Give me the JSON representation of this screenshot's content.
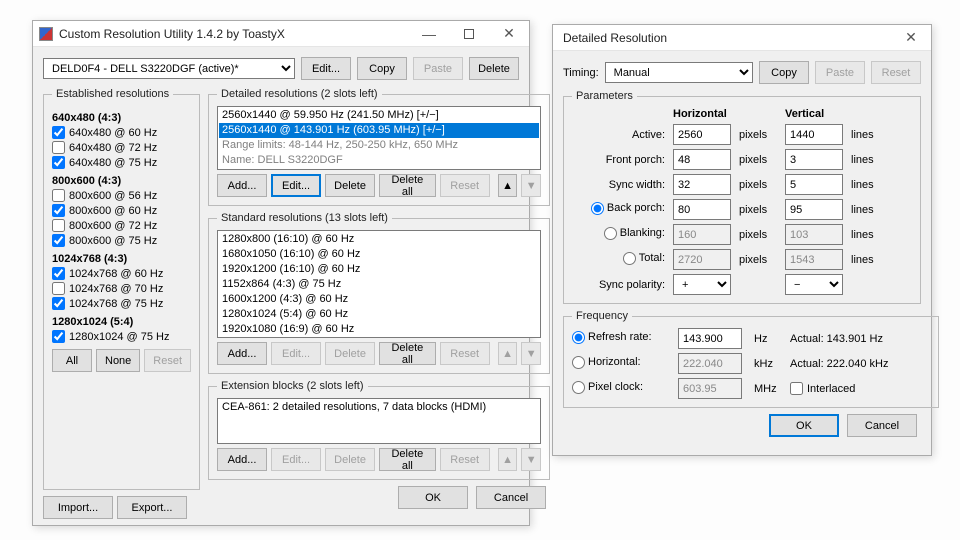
{
  "win1": {
    "title": "Custom Resolution Utility 1.4.2 by ToastyX",
    "monitor": "DELD0F4 - DELL S3220DGF (active)*",
    "topbtns": {
      "edit": "Edit...",
      "copy": "Copy",
      "paste": "Paste",
      "delete": "Delete"
    },
    "established": {
      "legend": "Established resolutions",
      "groups": [
        {
          "head": "640x480 (4:3)",
          "items": [
            {
              "label": "640x480 @ 60 Hz",
              "chk": true
            },
            {
              "label": "640x480 @ 72 Hz",
              "chk": false
            },
            {
              "label": "640x480 @ 75 Hz",
              "chk": true
            }
          ]
        },
        {
          "head": "800x600 (4:3)",
          "items": [
            {
              "label": "800x600 @ 56 Hz",
              "chk": false
            },
            {
              "label": "800x600 @ 60 Hz",
              "chk": true
            },
            {
              "label": "800x600 @ 72 Hz",
              "chk": false
            },
            {
              "label": "800x600 @ 75 Hz",
              "chk": true
            }
          ]
        },
        {
          "head": "1024x768 (4:3)",
          "items": [
            {
              "label": "1024x768 @ 60 Hz",
              "chk": true
            },
            {
              "label": "1024x768 @ 70 Hz",
              "chk": false
            },
            {
              "label": "1024x768 @ 75 Hz",
              "chk": true
            }
          ]
        },
        {
          "head": "1280x1024 (5:4)",
          "items": [
            {
              "label": "1280x1024 @ 75 Hz",
              "chk": true
            }
          ]
        }
      ],
      "all": "All",
      "none": "None",
      "reset": "Reset"
    },
    "detailed": {
      "legend": "Detailed resolutions (2 slots left)",
      "items": [
        {
          "text": "2560x1440 @ 59.950 Hz (241.50 MHz) [+/−]",
          "sel": false
        },
        {
          "text": "2560x1440 @ 143.901 Hz (603.95 MHz) [+/−]",
          "sel": true
        },
        {
          "text": "Range limits: 48-144 Hz, 250-250 kHz, 650 MHz",
          "dim": true
        },
        {
          "text": "Name: DELL S3220DGF",
          "dim": true
        }
      ],
      "add": "Add...",
      "edit": "Edit...",
      "delete": "Delete",
      "deleteall": "Delete all",
      "reset": "Reset"
    },
    "standard": {
      "legend": "Standard resolutions (13 slots left)",
      "items": [
        "1280x800 (16:10) @ 60 Hz",
        "1680x1050 (16:10) @ 60 Hz",
        "1920x1200 (16:10) @ 60 Hz",
        "1152x864 (4:3) @ 75 Hz",
        "1600x1200 (4:3) @ 60 Hz",
        "1280x1024 (5:4) @ 60 Hz",
        "1920x1080 (16:9) @ 60 Hz"
      ],
      "add": "Add...",
      "edit": "Edit...",
      "delete": "Delete",
      "deleteall": "Delete all",
      "reset": "Reset"
    },
    "ext": {
      "legend": "Extension blocks (2 slots left)",
      "items": [
        "CEA-861: 2 detailed resolutions, 7 data blocks (HDMI)"
      ],
      "add": "Add...",
      "edit": "Edit...",
      "delete": "Delete",
      "deleteall": "Delete all",
      "reset": "Reset"
    },
    "footer": {
      "import": "Import...",
      "export": "Export...",
      "ok": "OK",
      "cancel": "Cancel"
    }
  },
  "win2": {
    "title": "Detailed Resolution",
    "timing_lbl": "Timing:",
    "timing_val": "Manual",
    "copy": "Copy",
    "paste": "Paste",
    "reset": "Reset",
    "params": {
      "legend": "Parameters",
      "h_head": "Horizontal",
      "v_head": "Vertical",
      "rows": [
        {
          "label": "Active:",
          "h": "2560",
          "hu": "pixels",
          "v": "1440",
          "vu": "lines",
          "radio": false
        },
        {
          "label": "Front porch:",
          "h": "48",
          "hu": "pixels",
          "v": "3",
          "vu": "lines",
          "radio": false
        },
        {
          "label": "Sync width:",
          "h": "32",
          "hu": "pixels",
          "v": "5",
          "vu": "lines",
          "radio": false
        },
        {
          "label": "Back porch:",
          "h": "80",
          "hu": "pixels",
          "v": "95",
          "vu": "lines",
          "radio": true,
          "checked": true
        },
        {
          "label": "Blanking:",
          "h": "160",
          "hu": "pixels",
          "v": "103",
          "vu": "lines",
          "radio": true,
          "checked": false,
          "disabled": true
        },
        {
          "label": "Total:",
          "h": "2720",
          "hu": "pixels",
          "v": "1543",
          "vu": "lines",
          "radio": true,
          "checked": false,
          "disabled": true
        }
      ],
      "sync_lbl": "Sync polarity:",
      "sync_h": "+",
      "sync_v": "−"
    },
    "freq": {
      "legend": "Frequency",
      "rows": [
        {
          "label": "Refresh rate:",
          "val": "143.900",
          "unit": "Hz",
          "actual": "Actual: 143.901 Hz",
          "radio": true,
          "checked": true
        },
        {
          "label": "Horizontal:",
          "val": "222.040",
          "unit": "kHz",
          "actual": "Actual: 222.040 kHz",
          "radio": true,
          "checked": false,
          "disabled": true
        },
        {
          "label": "Pixel clock:",
          "val": "603.95",
          "unit": "MHz",
          "interlaced": "Interlaced",
          "radio": true,
          "checked": false,
          "disabled": true
        }
      ]
    },
    "ok": "OK",
    "cancel": "Cancel"
  }
}
